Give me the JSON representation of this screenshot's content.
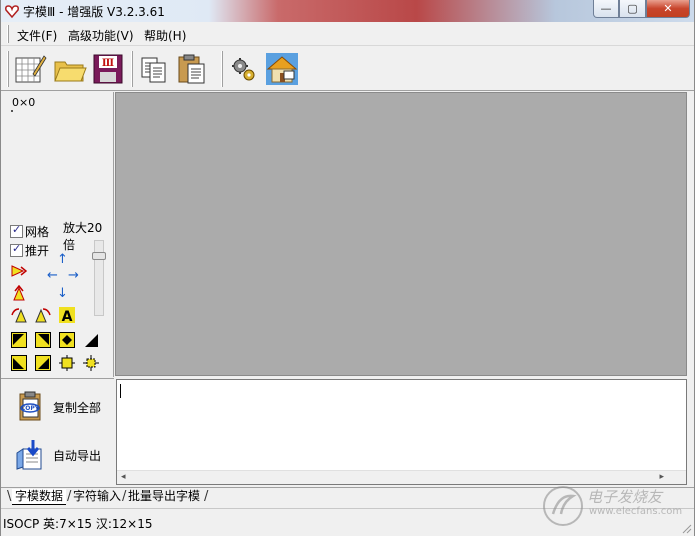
{
  "window": {
    "title": "字模Ⅲ - 增强版 V3.2.3.61",
    "controls": {
      "minimize": "—",
      "maximize": "▢",
      "close": "✕"
    }
  },
  "menu": [
    {
      "label": "文件(F)"
    },
    {
      "label": "高级功能(V)"
    },
    {
      "label": "帮助(H)"
    }
  ],
  "toolbar": {
    "buttons": [
      {
        "icon": "new-grid-icon"
      },
      {
        "icon": "open-folder-icon"
      },
      {
        "icon": "save-disk-icon"
      },
      {
        "icon": "copy-icon"
      },
      {
        "icon": "paste-clipboard-icon"
      },
      {
        "icon": "settings-gears-icon"
      },
      {
        "icon": "home-house-icon"
      }
    ]
  },
  "left_panel": {
    "size_readout": "0×0",
    "grid_label": "网格",
    "grid_checked": true,
    "push_label": "推开",
    "push_checked": true,
    "zoom_label": "放大20倍",
    "arrows": {
      "up": "↑",
      "left": "←",
      "right": "→",
      "down": "↓"
    }
  },
  "bottom_panel": {
    "copy_all_label": "复制全部",
    "auto_export_label": "自动导出",
    "scroll_left": "◂",
    "scroll_right": "▸"
  },
  "tabs": [
    {
      "label": "字模数据",
      "active": true
    },
    {
      "label": "字符输入",
      "active": false
    },
    {
      "label": "批量导出字模",
      "active": false
    }
  ],
  "status": {
    "text": "ISOCP 英:7×15 汉:12×15"
  },
  "watermark": {
    "text": "电子发烧友",
    "url": "www.elecfans.com"
  }
}
